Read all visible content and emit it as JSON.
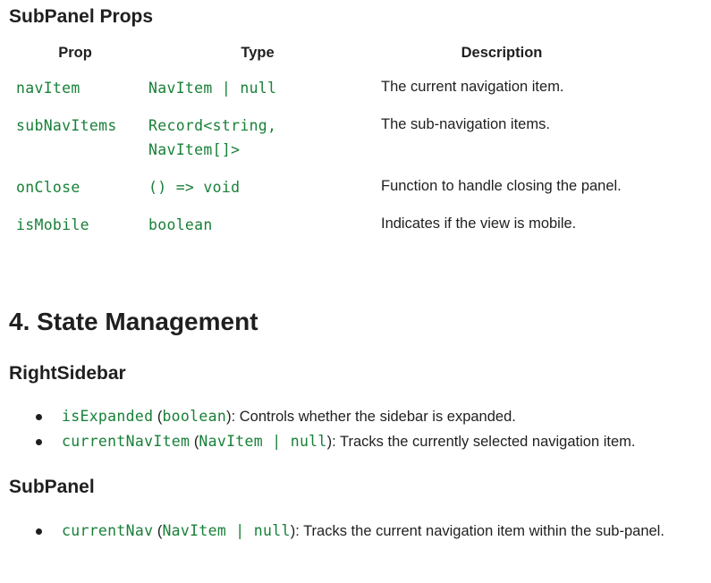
{
  "section_subpanel_props": {
    "title": "SubPanel Props",
    "headers": {
      "prop": "Prop",
      "type": "Type",
      "description": "Description"
    },
    "rows": [
      {
        "prop": "navItem",
        "type_line1": "NavItem | null",
        "type_line2": "",
        "description": "The current navigation item."
      },
      {
        "prop": "subNavItems",
        "type_line1": "Record<string,",
        "type_line2": "NavItem[]>",
        "description": "The sub-navigation items."
      },
      {
        "prop": "onClose",
        "type_line1": "() => void",
        "type_line2": "",
        "description": "Function to handle closing the panel."
      },
      {
        "prop": "isMobile",
        "type_line1": "boolean",
        "type_line2": "",
        "description": "Indicates if the view is mobile."
      }
    ]
  },
  "section_state": {
    "title": "4. State Management"
  },
  "section_rightsidebar": {
    "title": "RightSidebar",
    "items": [
      {
        "name": "isExpanded",
        "open": " (",
        "type": "boolean",
        "rest": "): Controls whether the sidebar is expanded."
      },
      {
        "name": "currentNavItem",
        "open": " (",
        "type": "NavItem | null",
        "rest": "): Tracks the currently selected navigation item."
      }
    ]
  },
  "section_subpanel": {
    "title": "SubPanel",
    "items": [
      {
        "name": "currentNav",
        "open": " (",
        "type": "NavItem | null",
        "rest": "): Tracks the current navigation item within the sub-panel."
      }
    ]
  }
}
